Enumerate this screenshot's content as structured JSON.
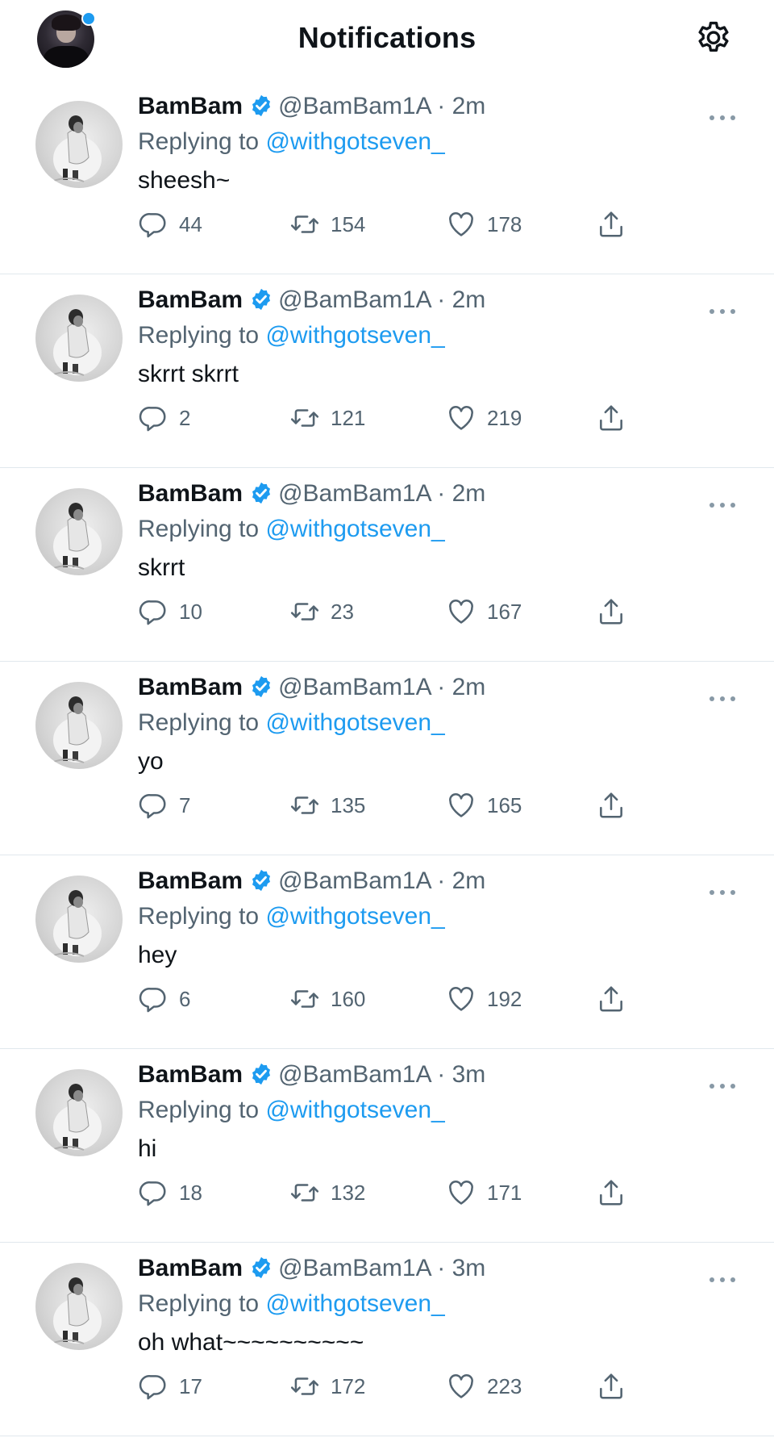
{
  "header": {
    "title": "Notifications",
    "unread_dot_color": "#1d9bf0",
    "settings_icon": "gear-icon"
  },
  "colors": {
    "accent": "#1d9bf0",
    "text_primary": "#0f1419",
    "text_secondary": "#536471",
    "divider": "#e1e8ed"
  },
  "tweets": [
    {
      "name": "BamBam",
      "verified": true,
      "handle": "@BamBam1A",
      "separator": "·",
      "time": "2m",
      "replying_prefix": "Replying to",
      "replying_to": "@withgotseven_",
      "text": "sheesh~",
      "replies": "44",
      "retweets": "154",
      "likes": "178"
    },
    {
      "name": "BamBam",
      "verified": true,
      "handle": "@BamBam1A",
      "separator": "·",
      "time": "2m",
      "replying_prefix": "Replying to",
      "replying_to": "@withgotseven_",
      "text": "skrrt skrrt",
      "replies": "2",
      "retweets": "121",
      "likes": "219"
    },
    {
      "name": "BamBam",
      "verified": true,
      "handle": "@BamBam1A",
      "separator": "·",
      "time": "2m",
      "replying_prefix": "Replying to",
      "replying_to": "@withgotseven_",
      "text": "skrrt",
      "replies": "10",
      "retweets": "23",
      "likes": "167"
    },
    {
      "name": "BamBam",
      "verified": true,
      "handle": "@BamBam1A",
      "separator": "·",
      "time": "2m",
      "replying_prefix": "Replying to",
      "replying_to": "@withgotseven_",
      "text": "yo",
      "replies": "7",
      "retweets": "135",
      "likes": "165"
    },
    {
      "name": "BamBam",
      "verified": true,
      "handle": "@BamBam1A",
      "separator": "·",
      "time": "2m",
      "replying_prefix": "Replying to",
      "replying_to": "@withgotseven_",
      "text": "hey",
      "replies": "6",
      "retweets": "160",
      "likes": "192"
    },
    {
      "name": "BamBam",
      "verified": true,
      "handle": "@BamBam1A",
      "separator": "·",
      "time": "3m",
      "replying_prefix": "Replying to",
      "replying_to": "@withgotseven_",
      "text": "hi",
      "replies": "18",
      "retweets": "132",
      "likes": "171"
    },
    {
      "name": "BamBam",
      "verified": true,
      "handle": "@BamBam1A",
      "separator": "·",
      "time": "3m",
      "replying_prefix": "Replying to",
      "replying_to": "@withgotseven_",
      "text": "oh what~~~~~~~~~~",
      "replies": "17",
      "retweets": "172",
      "likes": "223"
    }
  ]
}
